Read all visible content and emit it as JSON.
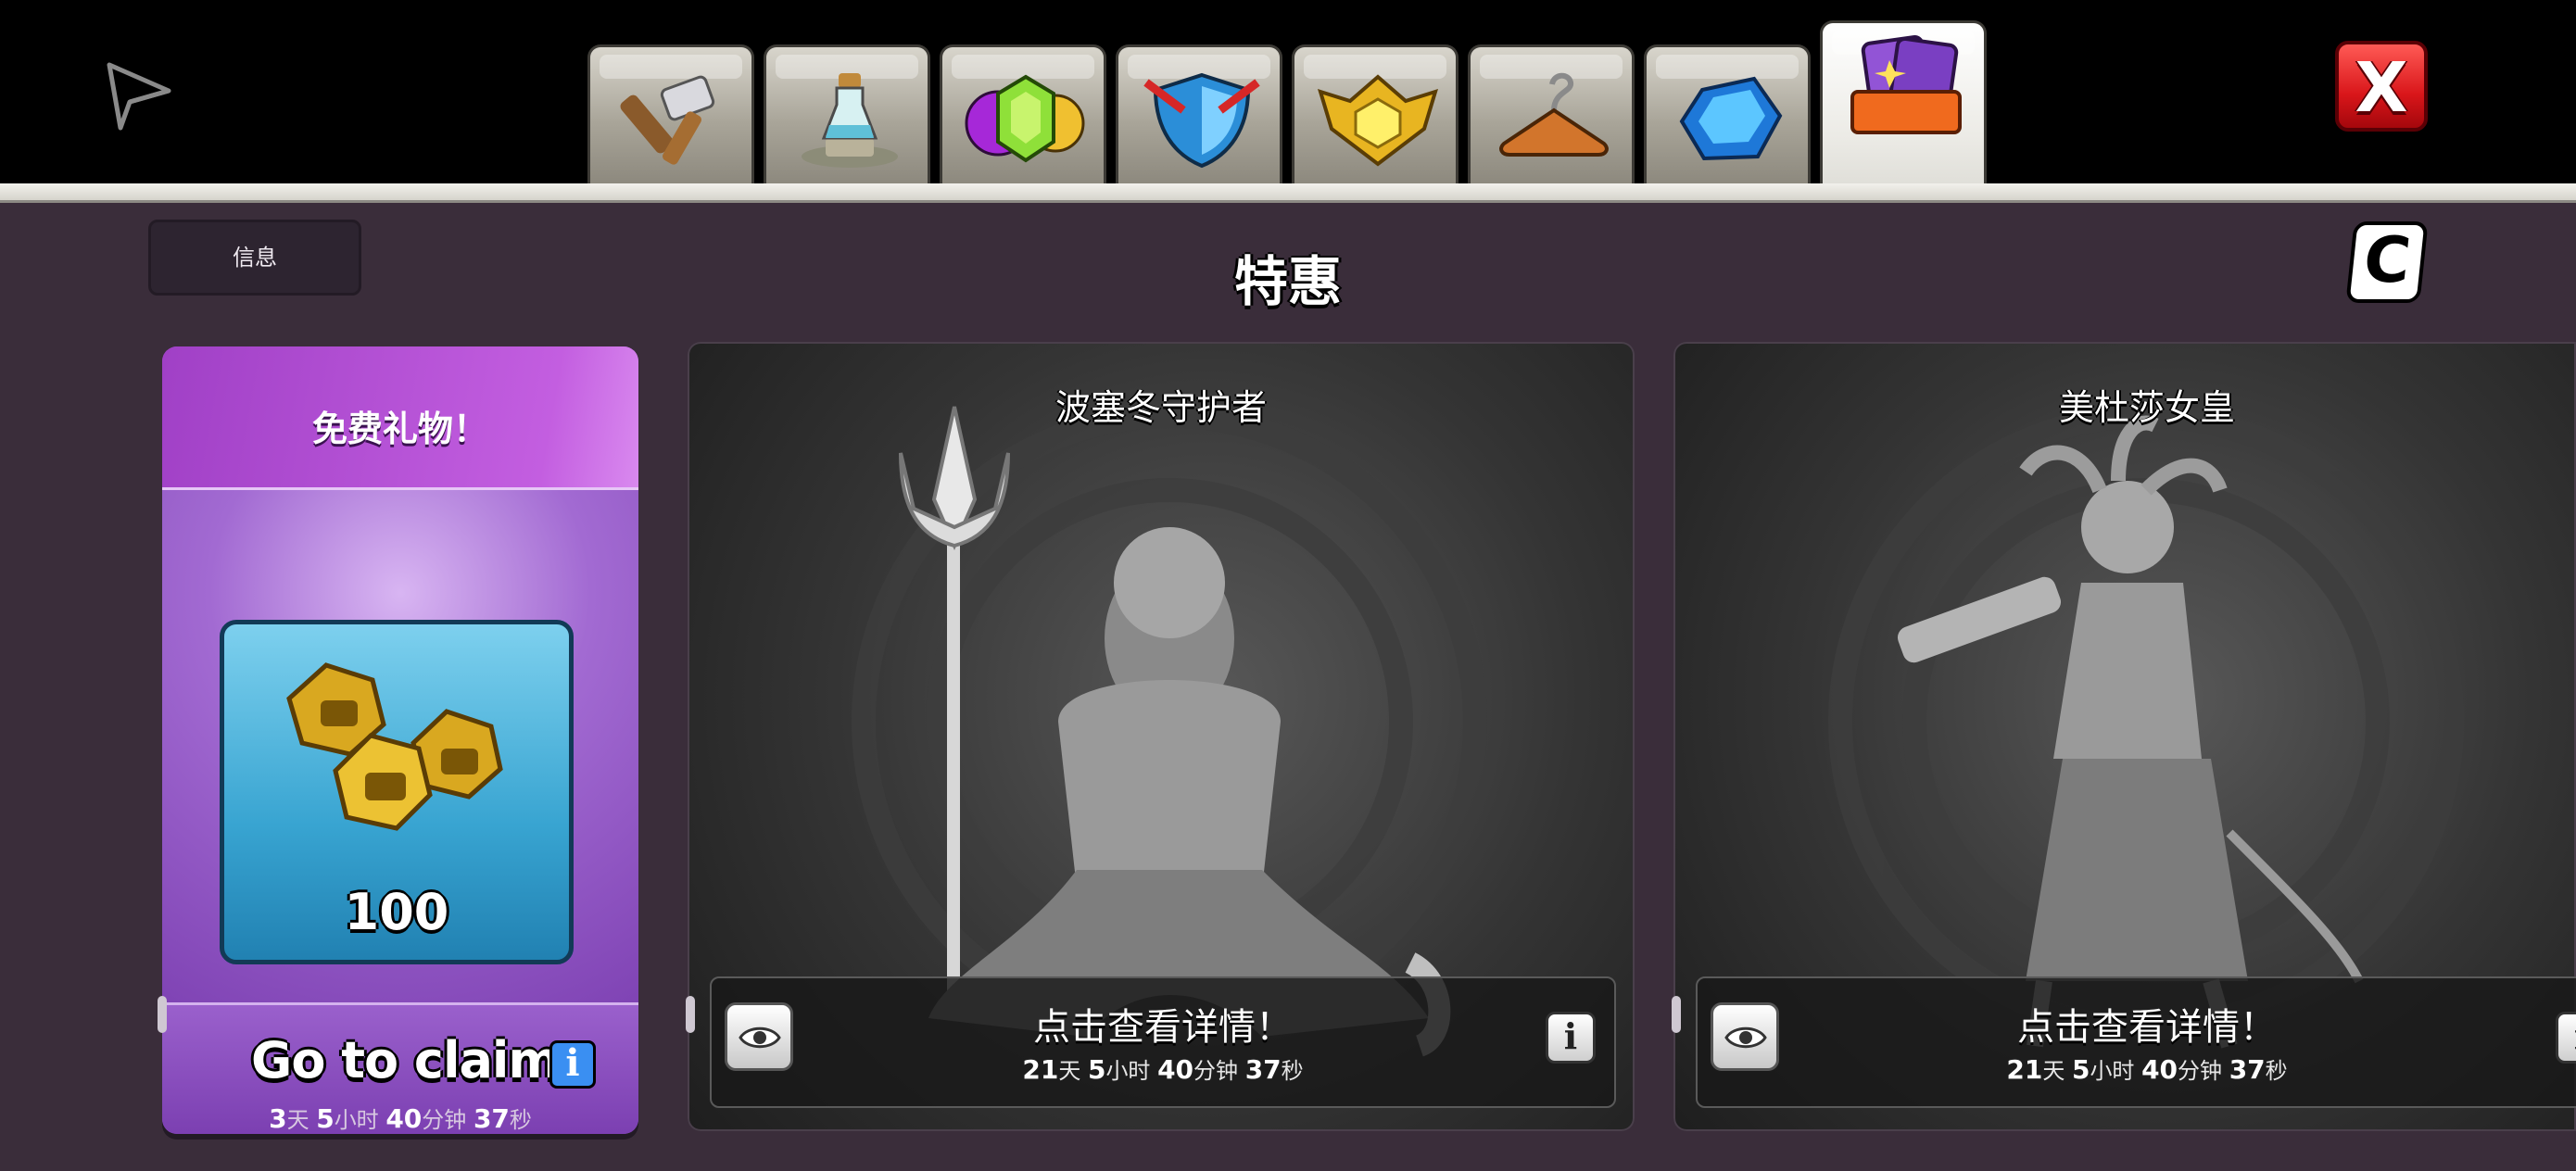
{
  "tabs": [
    {
      "name": "builder-tools",
      "active": false
    },
    {
      "name": "potion",
      "active": false
    },
    {
      "name": "resources",
      "active": false
    },
    {
      "name": "shield",
      "active": false
    },
    {
      "name": "league-badge",
      "active": false
    },
    {
      "name": "hanger",
      "active": false
    },
    {
      "name": "gems",
      "active": false
    },
    {
      "name": "special-offers",
      "active": true
    }
  ],
  "header": {
    "close_label": "X"
  },
  "main": {
    "info_label": "信息",
    "title": "特惠",
    "c_button_label": "C"
  },
  "gift": {
    "title": "免费礼物！",
    "amount": "100",
    "claim_label": "Go to claim",
    "claim_info": "i",
    "timer": {
      "d": "3",
      "d_unit": "天",
      "h": "5",
      "h_unit": "小时",
      "m": "40",
      "m_unit": "分钟",
      "s": "37",
      "s_unit": "秒"
    }
  },
  "offers": [
    {
      "name": "波塞冬守护者",
      "cta": "点击查看详情！",
      "info": "i",
      "timer": {
        "d": "21",
        "d_unit": "天",
        "h": "5",
        "h_unit": "小时",
        "m": "40",
        "m_unit": "分钟",
        "s": "37",
        "s_unit": "秒"
      }
    },
    {
      "name": "美杜莎女皇",
      "cta": "点击查看详情！",
      "info": "i",
      "timer": {
        "d": "21",
        "d_unit": "天",
        "h": "5",
        "h_unit": "小时",
        "m": "40",
        "m_unit": "分钟",
        "s": "37",
        "s_unit": "秒"
      }
    }
  ],
  "colors": {
    "main_bg": "#3a2d3a",
    "gift_purple": "#8f55c2",
    "reward_blue": "#38a4d1",
    "close_red": "#d9161a"
  }
}
